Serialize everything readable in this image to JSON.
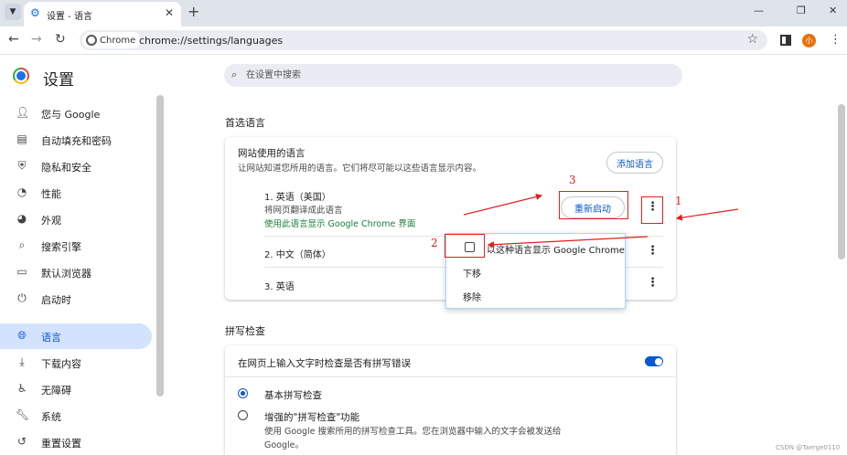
{
  "tab": {
    "title": "设置 - 语言",
    "close": "✕"
  },
  "omnibox": {
    "chip": "Chrome",
    "url": "chrome://settings/languages"
  },
  "profile_initial": "小",
  "header": {
    "title": "设置",
    "search_placeholder": "在设置中搜索"
  },
  "sidebar": {
    "items": [
      {
        "label": "您与 Google",
        "icon": "person-icon"
      },
      {
        "label": "自动填充和密码",
        "icon": "clipboard-icon"
      },
      {
        "label": "隐私和安全",
        "icon": "shield-icon"
      },
      {
        "label": "性能",
        "icon": "speedometer-icon"
      },
      {
        "label": "外观",
        "icon": "palette-icon"
      },
      {
        "label": "搜索引擎",
        "icon": "search-icon"
      },
      {
        "label": "默认浏览器",
        "icon": "browser-icon"
      },
      {
        "label": "启动时",
        "icon": "power-icon"
      },
      {
        "label": "语言",
        "icon": "globe-icon",
        "active": true
      },
      {
        "label": "下载内容",
        "icon": "download-icon"
      },
      {
        "label": "无障碍",
        "icon": "accessibility-icon"
      },
      {
        "label": "系统",
        "icon": "wrench-icon"
      },
      {
        "label": "重置设置",
        "icon": "reset-icon"
      }
    ]
  },
  "preferred": {
    "section_title": "首选语言",
    "card_title": "网站使用的语言",
    "card_desc": "让网站知道您所用的语言。它们将尽可能以这些语言显示内容。",
    "add_button": "添加语言",
    "restart_button": "重新启动",
    "languages": [
      {
        "name": "1. 英语（美国）",
        "sub": "将网页翻译成此语言",
        "note": "使用此语言显示 Google Chrome 界面"
      },
      {
        "name": "2. 中文（简体）"
      },
      {
        "name": "3. 英语"
      }
    ]
  },
  "menu": {
    "display_in_chrome": "以这种语言显示 Google Chrome",
    "move_down": "下移",
    "remove": "移除"
  },
  "annotations": {
    "one": "1",
    "two": "2",
    "three": "3"
  },
  "spellcheck": {
    "section_title": "拼写检查",
    "toggle_label": "在网页上输入文字时检查是否有拼写错误",
    "basic": "基本拼写检查",
    "enhanced": "增强的\"拼写检查\"功能",
    "enhanced_desc_1": "使用 Google 搜索所用的拼写检查工具。您在浏览器中输入的文字会被发送给",
    "enhanced_desc_2": "Google。"
  },
  "watermark": "CSDN @Taerge0110"
}
